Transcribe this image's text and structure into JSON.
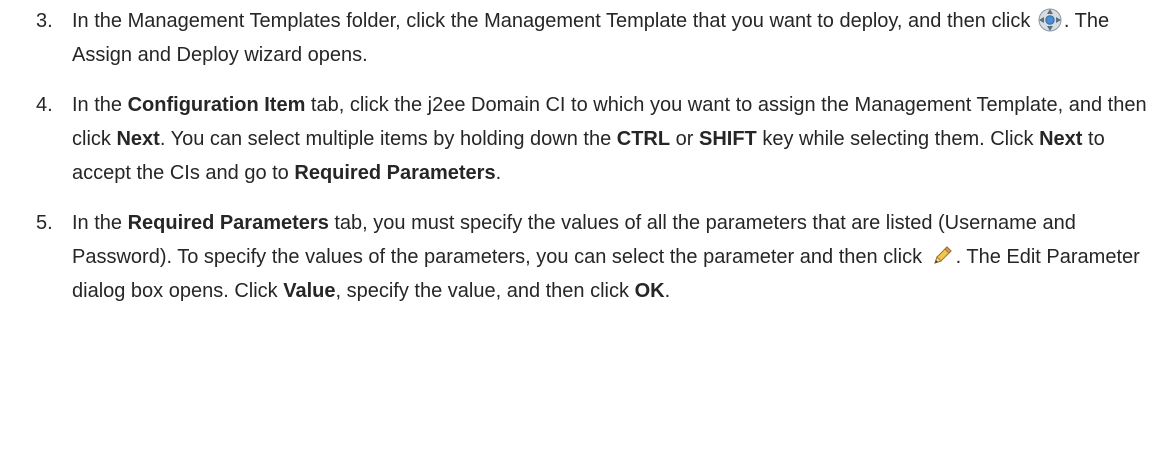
{
  "steps": [
    {
      "number": "3.",
      "parts": {
        "a": "In the Management Templates folder, click the Management Template that you want to deploy, and then click ",
        "b": ". The Assign and Deploy wizard opens."
      },
      "icon": "assign-deploy-icon"
    },
    {
      "number": "4.",
      "parts": {
        "a": "In the ",
        "b1": "Configuration Item",
        "c": " tab, click the j2ee Domain CI to which you want to assign the Management Template, and then click ",
        "b2": "Next",
        "d": ". You can select multiple items by holding down the ",
        "b3": "CTRL",
        "e": " or ",
        "b4": "SHIFT",
        "f": " key while selecting them. Click ",
        "b5": "Next",
        "g": " to accept the CIs and go to ",
        "b6": "Required Parameters",
        "h": "."
      }
    },
    {
      "number": "5.",
      "parts": {
        "a": "In the ",
        "b1": "Required Parameters",
        "c": " tab, you must specify the values of all the parameters that are listed (Username and Password). To specify the values of the parameters, you can select the parameter and then click ",
        "d": ". The Edit Parameter dialog box opens. Click ",
        "b2": "Value",
        "e": ", specify the value, and then click ",
        "b3": "OK",
        "f": "."
      },
      "icon": "pencil-edit-icon"
    }
  ]
}
